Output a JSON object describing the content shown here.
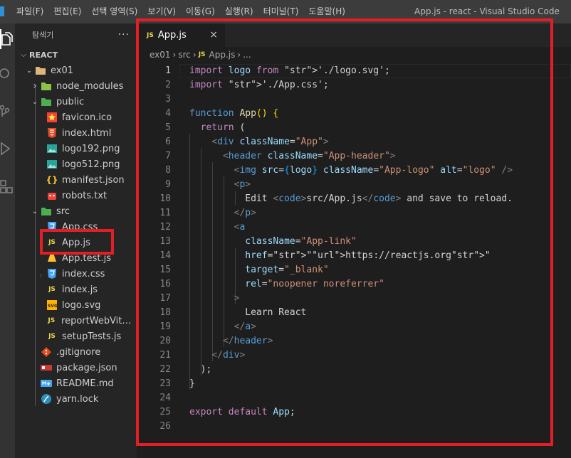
{
  "menu": [
    "파일(F)",
    "편집(E)",
    "선택 영역(S)",
    "보기(V)",
    "이동(G)",
    "실행(R)",
    "터미널(T)",
    "도움말(H)"
  ],
  "window_title": "App.js - react - Visual Studio Code",
  "explorer": {
    "title": "탐색기",
    "more": "···",
    "section": "REACT",
    "items": [
      {
        "label": "ex01",
        "kind": "folder-open",
        "depth": 1,
        "icon": "folder-icon"
      },
      {
        "label": "node_modules",
        "kind": "folder-closed",
        "depth": 2,
        "icon": "node-modules-folder-icon"
      },
      {
        "label": "public",
        "kind": "folder-open",
        "depth": 2,
        "icon": "public-folder-icon"
      },
      {
        "label": "favicon.ico",
        "kind": "file",
        "depth": 3,
        "icon": "favicon-star-icon"
      },
      {
        "label": "index.html",
        "kind": "file",
        "depth": 3,
        "icon": "html5-icon"
      },
      {
        "label": "logo192.png",
        "kind": "file",
        "depth": 3,
        "icon": "image-icon"
      },
      {
        "label": "logo512.png",
        "kind": "file",
        "depth": 3,
        "icon": "image-icon"
      },
      {
        "label": "manifest.json",
        "kind": "file",
        "depth": 3,
        "icon": "json-braces-icon"
      },
      {
        "label": "robots.txt",
        "kind": "file",
        "depth": 3,
        "icon": "robot-icon"
      },
      {
        "label": "src",
        "kind": "folder-open",
        "depth": 2,
        "icon": "src-folder-icon"
      },
      {
        "label": "App.css",
        "kind": "file",
        "depth": 3,
        "icon": "css3-icon"
      },
      {
        "label": "App.js",
        "kind": "file",
        "depth": 3,
        "icon": "js-icon"
      },
      {
        "label": "App.test.js",
        "kind": "file",
        "depth": 3,
        "icon": "test-js-icon"
      },
      {
        "label": "index.css",
        "kind": "file",
        "depth": 3,
        "icon": "css3-icon"
      },
      {
        "label": "index.js",
        "kind": "file",
        "depth": 3,
        "icon": "js-icon"
      },
      {
        "label": "logo.svg",
        "kind": "file",
        "depth": 3,
        "icon": "svg-icon"
      },
      {
        "label": "reportWebVital...",
        "kind": "file",
        "depth": 3,
        "icon": "js-icon"
      },
      {
        "label": "setupTests.js",
        "kind": "file",
        "depth": 3,
        "icon": "js-icon"
      },
      {
        "label": ".gitignore",
        "kind": "file",
        "depth": 2,
        "icon": "git-icon"
      },
      {
        "label": "package.json",
        "kind": "file",
        "depth": 2,
        "icon": "npm-icon"
      },
      {
        "label": "README.md",
        "kind": "file",
        "depth": 2,
        "icon": "markdown-icon"
      },
      {
        "label": "yarn.lock",
        "kind": "file",
        "depth": 2,
        "icon": "yarn-icon"
      }
    ]
  },
  "tab": {
    "icon_text": "JS",
    "label": "App.js",
    "close": "×"
  },
  "breadcrumb": [
    "ex01",
    "src",
    "App.js",
    "..."
  ],
  "line_numbers": [
    "1",
    "2",
    "3",
    "4",
    "5",
    "6",
    "7",
    "8",
    "9",
    "10",
    "11",
    "12",
    "13",
    "14",
    "15",
    "16",
    "17",
    "18",
    "19",
    "20",
    "21",
    "22",
    "23",
    "24",
    "25",
    "26"
  ],
  "code_lines": [
    "import logo from './logo.svg';",
    "import './App.css';",
    "",
    "function App() {",
    "  return (",
    "    <div className=\"App\">",
    "      <header className=\"App-header\">",
    "        <img src={logo} className=\"App-logo\" alt=\"logo\" />",
    "        <p>",
    "          Edit <code>src/App.js</code> and save to reload.",
    "        </p>",
    "        <a",
    "          className=\"App-link\"",
    "          href=\"https://reactjs.org\"",
    "          target=\"_blank\"",
    "          rel=\"noopener noreferrer\"",
    "        >",
    "          Learn React",
    "        </a>",
    "      </header>",
    "    </div>",
    "  );",
    "}",
    "",
    "export default App;",
    ""
  ],
  "colors": {
    "highlight": "#e51e25",
    "js_yellow": "#e8d44d",
    "keyword": "#c586c0",
    "string": "#ce9178",
    "tag": "#569cd6"
  }
}
